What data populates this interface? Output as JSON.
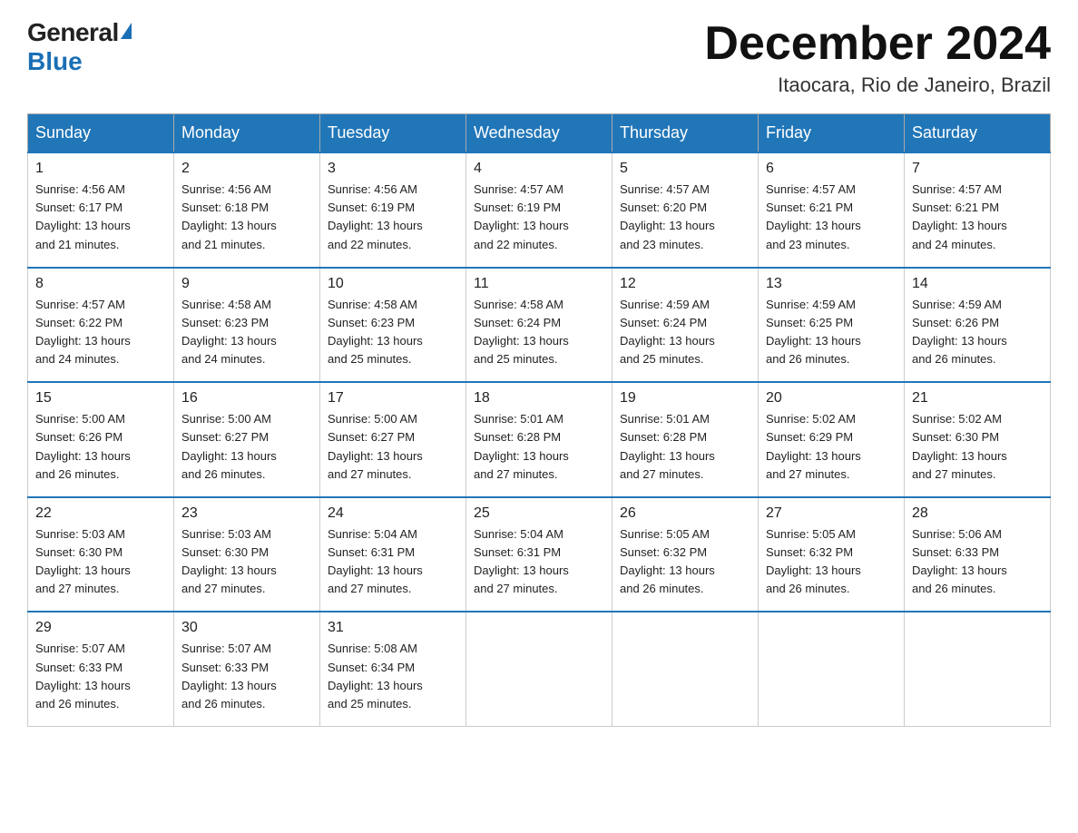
{
  "logo": {
    "general": "General",
    "blue": "Blue"
  },
  "title": "December 2024",
  "location": "Itaocara, Rio de Janeiro, Brazil",
  "weekdays": [
    "Sunday",
    "Monday",
    "Tuesday",
    "Wednesday",
    "Thursday",
    "Friday",
    "Saturday"
  ],
  "weeks": [
    [
      {
        "day": "1",
        "sunrise": "4:56 AM",
        "sunset": "6:17 PM",
        "daylight": "13 hours and 21 minutes."
      },
      {
        "day": "2",
        "sunrise": "4:56 AM",
        "sunset": "6:18 PM",
        "daylight": "13 hours and 21 minutes."
      },
      {
        "day": "3",
        "sunrise": "4:56 AM",
        "sunset": "6:19 PM",
        "daylight": "13 hours and 22 minutes."
      },
      {
        "day": "4",
        "sunrise": "4:57 AM",
        "sunset": "6:19 PM",
        "daylight": "13 hours and 22 minutes."
      },
      {
        "day": "5",
        "sunrise": "4:57 AM",
        "sunset": "6:20 PM",
        "daylight": "13 hours and 23 minutes."
      },
      {
        "day": "6",
        "sunrise": "4:57 AM",
        "sunset": "6:21 PM",
        "daylight": "13 hours and 23 minutes."
      },
      {
        "day": "7",
        "sunrise": "4:57 AM",
        "sunset": "6:21 PM",
        "daylight": "13 hours and 24 minutes."
      }
    ],
    [
      {
        "day": "8",
        "sunrise": "4:57 AM",
        "sunset": "6:22 PM",
        "daylight": "13 hours and 24 minutes."
      },
      {
        "day": "9",
        "sunrise": "4:58 AM",
        "sunset": "6:23 PM",
        "daylight": "13 hours and 24 minutes."
      },
      {
        "day": "10",
        "sunrise": "4:58 AM",
        "sunset": "6:23 PM",
        "daylight": "13 hours and 25 minutes."
      },
      {
        "day": "11",
        "sunrise": "4:58 AM",
        "sunset": "6:24 PM",
        "daylight": "13 hours and 25 minutes."
      },
      {
        "day": "12",
        "sunrise": "4:59 AM",
        "sunset": "6:24 PM",
        "daylight": "13 hours and 25 minutes."
      },
      {
        "day": "13",
        "sunrise": "4:59 AM",
        "sunset": "6:25 PM",
        "daylight": "13 hours and 26 minutes."
      },
      {
        "day": "14",
        "sunrise": "4:59 AM",
        "sunset": "6:26 PM",
        "daylight": "13 hours and 26 minutes."
      }
    ],
    [
      {
        "day": "15",
        "sunrise": "5:00 AM",
        "sunset": "6:26 PM",
        "daylight": "13 hours and 26 minutes."
      },
      {
        "day": "16",
        "sunrise": "5:00 AM",
        "sunset": "6:27 PM",
        "daylight": "13 hours and 26 minutes."
      },
      {
        "day": "17",
        "sunrise": "5:00 AM",
        "sunset": "6:27 PM",
        "daylight": "13 hours and 27 minutes."
      },
      {
        "day": "18",
        "sunrise": "5:01 AM",
        "sunset": "6:28 PM",
        "daylight": "13 hours and 27 minutes."
      },
      {
        "day": "19",
        "sunrise": "5:01 AM",
        "sunset": "6:28 PM",
        "daylight": "13 hours and 27 minutes."
      },
      {
        "day": "20",
        "sunrise": "5:02 AM",
        "sunset": "6:29 PM",
        "daylight": "13 hours and 27 minutes."
      },
      {
        "day": "21",
        "sunrise": "5:02 AM",
        "sunset": "6:30 PM",
        "daylight": "13 hours and 27 minutes."
      }
    ],
    [
      {
        "day": "22",
        "sunrise": "5:03 AM",
        "sunset": "6:30 PM",
        "daylight": "13 hours and 27 minutes."
      },
      {
        "day": "23",
        "sunrise": "5:03 AM",
        "sunset": "6:30 PM",
        "daylight": "13 hours and 27 minutes."
      },
      {
        "day": "24",
        "sunrise": "5:04 AM",
        "sunset": "6:31 PM",
        "daylight": "13 hours and 27 minutes."
      },
      {
        "day": "25",
        "sunrise": "5:04 AM",
        "sunset": "6:31 PM",
        "daylight": "13 hours and 27 minutes."
      },
      {
        "day": "26",
        "sunrise": "5:05 AM",
        "sunset": "6:32 PM",
        "daylight": "13 hours and 26 minutes."
      },
      {
        "day": "27",
        "sunrise": "5:05 AM",
        "sunset": "6:32 PM",
        "daylight": "13 hours and 26 minutes."
      },
      {
        "day": "28",
        "sunrise": "5:06 AM",
        "sunset": "6:33 PM",
        "daylight": "13 hours and 26 minutes."
      }
    ],
    [
      {
        "day": "29",
        "sunrise": "5:07 AM",
        "sunset": "6:33 PM",
        "daylight": "13 hours and 26 minutes."
      },
      {
        "day": "30",
        "sunrise": "5:07 AM",
        "sunset": "6:33 PM",
        "daylight": "13 hours and 26 minutes."
      },
      {
        "day": "31",
        "sunrise": "5:08 AM",
        "sunset": "6:34 PM",
        "daylight": "13 hours and 25 minutes."
      },
      null,
      null,
      null,
      null
    ]
  ],
  "labels": {
    "sunrise": "Sunrise:",
    "sunset": "Sunset:",
    "daylight": "Daylight:"
  }
}
